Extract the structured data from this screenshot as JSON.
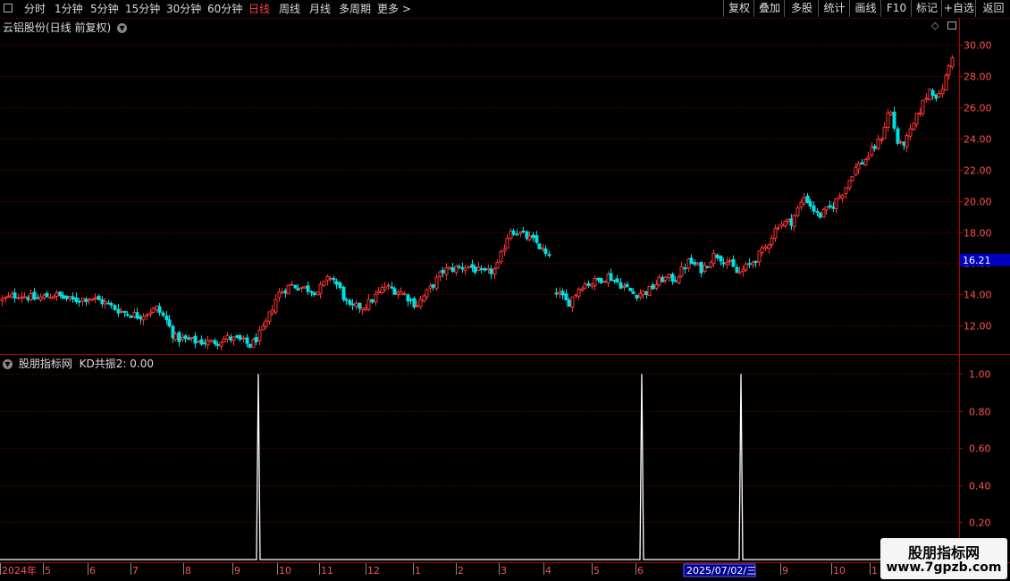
{
  "toolbar": {
    "periods": [
      "分时",
      "1分钟",
      "5分钟",
      "15分钟",
      "30分钟",
      "60分钟",
      "日线",
      "周线",
      "月线",
      "多周期",
      "更多 >"
    ],
    "active_period": "日线",
    "right_buttons": [
      "复权",
      "叠加",
      "多股",
      "统计",
      "画线",
      "F10",
      "标记",
      "+自选",
      "返回"
    ]
  },
  "main_panel": {
    "title": "云铝股份(日线 前复权)",
    "price_ticks": [
      "30.00",
      "28.00",
      "26.00",
      "24.00",
      "22.00",
      "20.00",
      "18.00",
      "16.00",
      "14.00",
      "12.00"
    ],
    "current_price": "16.21"
  },
  "indicator_panel": {
    "title": "股朋指标网",
    "formula": "KD共振2: 0.00",
    "ticks": [
      "1.00",
      "0.80",
      "0.60",
      "0.40",
      "0.20"
    ]
  },
  "date_axis": {
    "labels": [
      "2024年",
      "5",
      "6",
      "7",
      "8",
      "9",
      "10",
      "11",
      "12",
      "1",
      "2",
      "3",
      "4",
      "5",
      "6",
      "9",
      "10",
      "1"
    ],
    "cursor_date": "2025/07/02/三"
  },
  "watermark": {
    "title": "股朋指标网",
    "url": "www.7gpzb.com"
  },
  "colors": {
    "up": "#ff3333",
    "down": "#00e0e0",
    "grid": "#7a0000",
    "axis": "#b00000",
    "signal": "#ffffff",
    "price_badge": "#0000c0"
  },
  "chart_data": {
    "type": "candlestick",
    "anchor_closes": [
      [
        0,
        13.6
      ],
      [
        20,
        14.0
      ],
      [
        40,
        13.7
      ],
      [
        60,
        14.0
      ],
      [
        80,
        13.6
      ],
      [
        100,
        13.8
      ],
      [
        115,
        13.5
      ],
      [
        135,
        12.9
      ],
      [
        155,
        12.6
      ],
      [
        175,
        13.1
      ],
      [
        185,
        12.4
      ],
      [
        195,
        11.2
      ],
      [
        215,
        11.0
      ],
      [
        235,
        10.9
      ],
      [
        255,
        11.2
      ],
      [
        270,
        11.0
      ],
      [
        280,
        10.7
      ],
      [
        295,
        11.8
      ],
      [
        310,
        14.0
      ],
      [
        325,
        14.6
      ],
      [
        340,
        14.4
      ],
      [
        355,
        14.2
      ],
      [
        370,
        15.2
      ],
      [
        380,
        14.3
      ],
      [
        390,
        13.1
      ],
      [
        410,
        13.3
      ],
      [
        430,
        14.5
      ],
      [
        450,
        14.1
      ],
      [
        465,
        13.3
      ],
      [
        480,
        14.3
      ],
      [
        495,
        15.5
      ],
      [
        510,
        15.7
      ],
      [
        525,
        15.8
      ],
      [
        540,
        15.3
      ],
      [
        555,
        15.6
      ],
      [
        570,
        18.2
      ],
      [
        585,
        17.8
      ],
      [
        600,
        17.3
      ],
      [
        615,
        16.2
      ]
    ],
    "anchor_closes_after_gap": [
      [
        622,
        14.2
      ],
      [
        635,
        13.4
      ],
      [
        650,
        14.6
      ],
      [
        665,
        14.8
      ],
      [
        680,
        15.2
      ],
      [
        695,
        14.6
      ],
      [
        710,
        14.0
      ],
      [
        725,
        14.2
      ],
      [
        740,
        15.0
      ],
      [
        755,
        15.0
      ],
      [
        770,
        16.1
      ],
      [
        785,
        15.6
      ],
      [
        800,
        16.6
      ],
      [
        815,
        16.0
      ],
      [
        825,
        15.3
      ],
      [
        840,
        16.0
      ],
      [
        855,
        16.9
      ],
      [
        870,
        18.5
      ],
      [
        885,
        18.7
      ],
      [
        900,
        20.3
      ],
      [
        915,
        19.0
      ],
      [
        930,
        19.6
      ],
      [
        945,
        20.8
      ],
      [
        955,
        22.0
      ],
      [
        970,
        22.8
      ],
      [
        985,
        24.0
      ],
      [
        995,
        26.0
      ],
      [
        1005,
        23.4
      ],
      [
        1015,
        24.0
      ],
      [
        1030,
        26.0
      ],
      [
        1040,
        27.2
      ],
      [
        1050,
        26.6
      ],
      [
        1058,
        28.0
      ],
      [
        1066,
        29.6
      ]
    ],
    "y_range": [
      10.4,
      30.6
    ],
    "indicator": {
      "name": "KD共振2",
      "value": 0.0,
      "signal_days": [
        289,
        718,
        829
      ],
      "signal_value": 1.0,
      "y_range": [
        0,
        1.05
      ]
    }
  }
}
